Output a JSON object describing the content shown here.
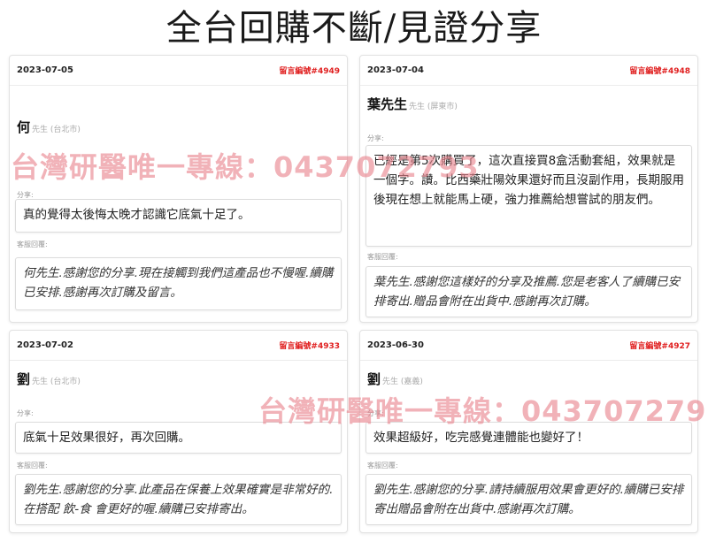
{
  "page": {
    "title": "全台回購不斷/見證分享"
  },
  "labels": {
    "share": "分享:",
    "reply": "客服回覆:"
  },
  "watermark": "台灣研醫唯一專線：0437072793",
  "cards": [
    {
      "date": "2023-07-05",
      "msg_no": "留言編號#4949",
      "name": "何",
      "name_sub": "先生 (台北市)",
      "share": "真的覺得太後悔太晚才認識它底氣十足了。",
      "reply": "何先生.感謝您的分享.現在接觸到我們這產品也不慢喔.續購已安排.感謝再次訂購及留言。"
    },
    {
      "date": "2023-07-04",
      "msg_no": "留言編號#4948",
      "name": "葉先生",
      "name_sub": "先生 (屏東市)",
      "share": "已經是第5次購買了，這次直接買8盒活動套組，效果就是一個字。讚。比西藥壯陽效果還好而且沒副作用，長期服用後現在想上就能馬上硬，強力推薦給想嘗試的朋友們。",
      "reply": "葉先生.感謝您這樣好的分享及推薦.您是老客人了續購已安排寄出.贈品會附在出貨中.感謝再次訂購。"
    },
    {
      "date": "2023-07-02",
      "msg_no": "留言編號#4933",
      "name": "劉",
      "name_sub": "先生 (台北市)",
      "share": "底氣十足效果很好，再次回購。",
      "reply": "劉先生.感謝您的分享.此產品在保養上效果確實是非常好的.在搭配 飲-食 會更好的喔.續購已安排寄出。"
    },
    {
      "date": "2023-06-30",
      "msg_no": "留言編號#4927",
      "name": "劉",
      "name_sub": "先生 (嘉義)",
      "share": "效果超級好，吃完感覺連體能也變好了！",
      "reply": "劉先生.感謝您的分享.請持續服用效果會更好的.續購已安排寄出贈品會附在出貨中.感謝再次訂購。"
    }
  ]
}
